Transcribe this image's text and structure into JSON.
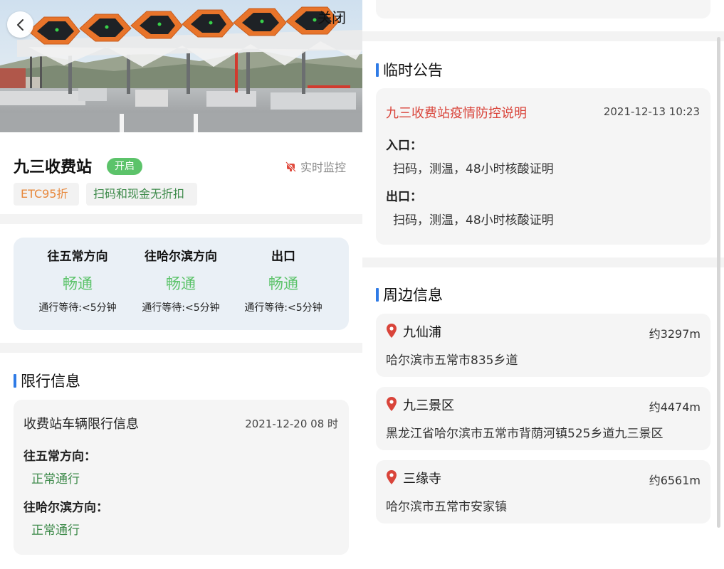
{
  "header": {
    "close_label": "关闭"
  },
  "station": {
    "name": "九三收费站",
    "status": "开启",
    "monitor_label": "实时监控",
    "tags": [
      "ETC95折",
      "扫码和现金无折扣"
    ]
  },
  "traffic": [
    {
      "direction": "往五常方向",
      "state": "畅通",
      "wait": "通行等待:<5分钟"
    },
    {
      "direction": "往哈尔滨方向",
      "state": "畅通",
      "wait": "通行等待:<5分钟"
    },
    {
      "direction": "出口",
      "state": "畅通",
      "wait": "通行等待:<5分钟"
    }
  ],
  "restrictions": {
    "section_title": "限行信息",
    "card_title": "收费站车辆限行信息",
    "time": "2021-12-20 08 时",
    "items": [
      {
        "label": "往五常方向：",
        "value": "正常通行"
      },
      {
        "label": "往哈尔滨方向：",
        "value": "正常通行"
      }
    ]
  },
  "notice": {
    "section_title": "临时公告",
    "title": "九三收费站疫情防控说明",
    "time": "2021-12-13 10:23",
    "items": [
      {
        "label": "入口：",
        "value": "扫码，测温，48小时核酸证明"
      },
      {
        "label": "出口：",
        "value": "扫码，测温，48小时核酸证明"
      }
    ]
  },
  "nearby": {
    "section_title": "周边信息",
    "items": [
      {
        "name": "九仙浦",
        "distance": "约3297m",
        "address": "哈尔滨市五常市835乡道"
      },
      {
        "name": "九三景区",
        "distance": "约4474m",
        "address": "黑龙江省哈尔滨市五常市背荫河镇525乡道九三景区"
      },
      {
        "name": "三缘寺",
        "distance": "约6561m",
        "address": "哈尔滨市五常市安家镇"
      }
    ]
  },
  "colors": {
    "accent_blue": "#2f7be6",
    "status_green": "#5cc36a",
    "text_green": "#3d8a4a",
    "notice_red": "#d9443a",
    "tag_orange": "#e7883c",
    "canopy_orange": "#e8742a"
  },
  "icons": [
    "back-arrow-icon",
    "monitor-off-icon",
    "location-pin-icon"
  ]
}
